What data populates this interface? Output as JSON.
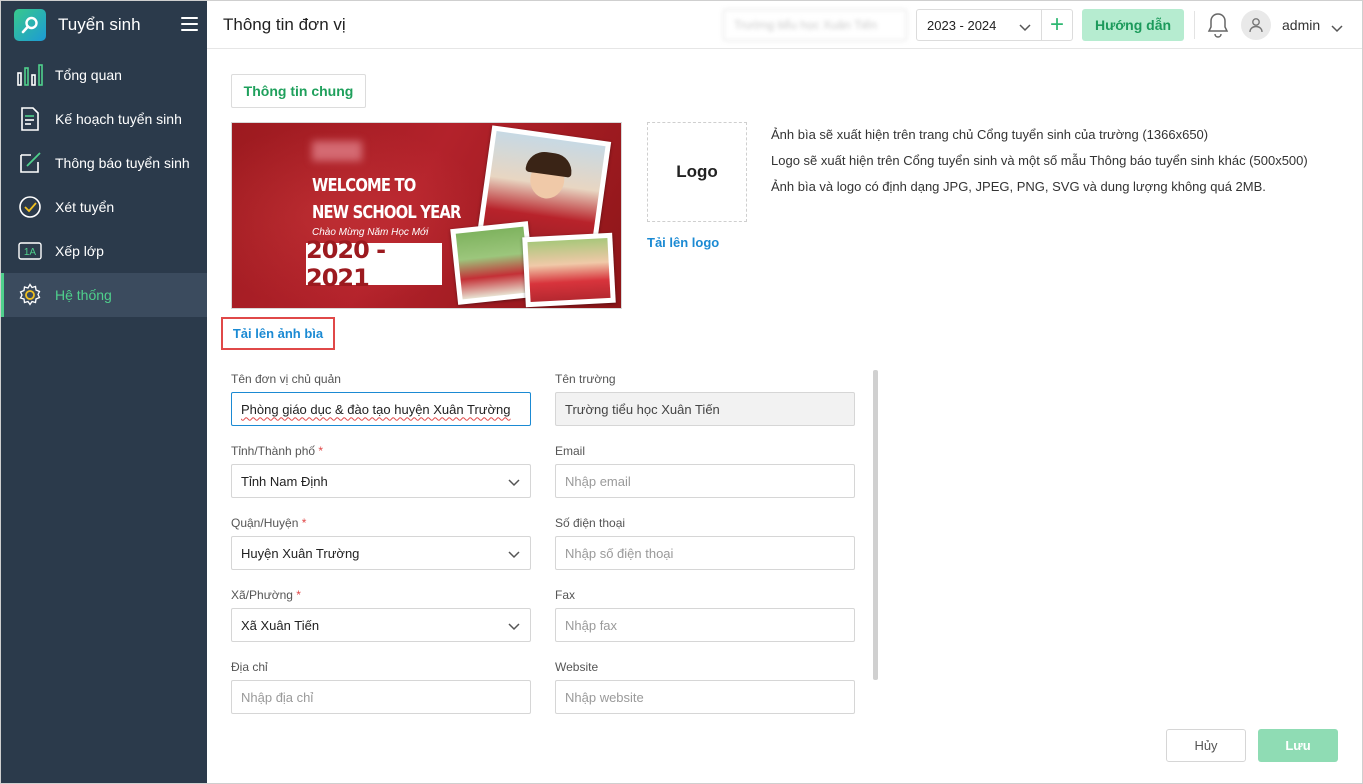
{
  "app": {
    "title": "Tuyển sinh"
  },
  "sidebar": {
    "items": [
      {
        "label": "Tổng quan",
        "icon": "bar-chart-icon"
      },
      {
        "label": "Kế hoạch tuyển sinh",
        "icon": "document-icon"
      },
      {
        "label": "Thông báo tuyển sinh",
        "icon": "edit-icon"
      },
      {
        "label": "Xét tuyển",
        "icon": "check-circle-icon"
      },
      {
        "label": "Xếp lớp",
        "icon": "class-1a-icon",
        "badge": "1A"
      },
      {
        "label": "Hệ thống",
        "icon": "gear-icon",
        "active": true
      }
    ]
  },
  "header": {
    "page_title": "Thông tin đơn vị",
    "school_select": "Trường tiểu học Xuân Tiến",
    "year_select": "2023 - 2024",
    "add_label": "+",
    "guide_label": "Hướng dẫn",
    "user_name": "admin"
  },
  "tabs": {
    "general": "Thông tin chung"
  },
  "cover": {
    "line1": "WELCOME TO",
    "line2": "NEW SCHOOL YEAR",
    "line3": "Chào Mừng Năm Học Mới",
    "year": "2020 - 2021",
    "upload_label": "Tải lên ảnh bìa"
  },
  "logo": {
    "placeholder": "Logo",
    "upload_label": "Tải lên logo"
  },
  "notes": [
    "Ảnh bìa sẽ xuất hiện trên trang chủ Cổng tuyển sinh của trường (1366x650)",
    "Logo sẽ xuất hiện trên Cổng tuyển sinh và một số mẫu Thông báo tuyển sinh khác (500x500)",
    "Ảnh bìa và logo có định dạng JPG, JPEG, PNG, SVG và dung lượng không quá 2MB."
  ],
  "form": {
    "managing_unit": {
      "label": "Tên đơn vị chủ quản",
      "value": "Phòng giáo dục & đào tạo huyện Xuân Trường"
    },
    "school_name": {
      "label": "Tên trường",
      "value": "Trường tiểu học Xuân Tiến"
    },
    "province": {
      "label": "Tỉnh/Thành phố",
      "required": "*",
      "value": "Tỉnh Nam Định"
    },
    "email": {
      "label": "Email",
      "placeholder": "Nhập email"
    },
    "district": {
      "label": "Quận/Huyện",
      "required": "*",
      "value": "Huyện Xuân Trường"
    },
    "phone": {
      "label": "Số điện thoại",
      "placeholder": "Nhập số điện thoại"
    },
    "ward": {
      "label": "Xã/Phường",
      "required": "*",
      "value": "Xã Xuân Tiến"
    },
    "fax": {
      "label": "Fax",
      "placeholder": "Nhập fax"
    },
    "address": {
      "label": "Địa chỉ",
      "placeholder": "Nhập địa chỉ"
    },
    "website": {
      "label": "Website",
      "placeholder": "Nhập website"
    }
  },
  "actions": {
    "cancel": "Hủy",
    "save": "Lưu"
  },
  "colors": {
    "sidebar_bg": "#2b3a4b",
    "accent": "#4fd08c",
    "link": "#1b8ad3",
    "cover_red": "#9c1a1f"
  }
}
